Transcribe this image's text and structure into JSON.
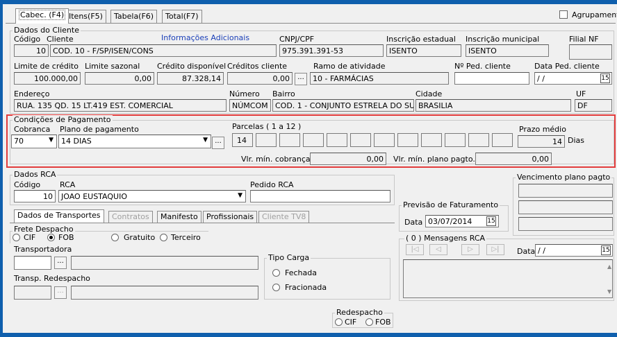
{
  "tabs": [
    {
      "label": "Cabec. (F4)"
    },
    {
      "label": "Itens(F5)"
    },
    {
      "label": "Tabela(F6)"
    },
    {
      "label": "Total(F7)"
    }
  ],
  "agrupamento_label": "Agrupament",
  "cliente": {
    "group_title": "Dados do Cliente",
    "codigo_label": "Código",
    "codigo_value": "10",
    "cliente_label": "Cliente",
    "cliente_value": "COD. 10 - F/SP/ISEN/CONS",
    "info_adicionais_link": "Informações Adicionais",
    "cnpj_label": "CNPJ/CPF",
    "cnpj_value": "975.391.391-53",
    "ie_label": "Inscrição estadual",
    "ie_value": "ISENTO",
    "im_label": "Inscrição municipal",
    "im_value": "ISENTO",
    "filial_label": "Filial NF",
    "filial_value": "",
    "limite_credito_label": "Limite de crédito",
    "limite_credito_value": "100.000,00",
    "limite_sazonal_label": "Limite sazonal",
    "limite_sazonal_value": "0,00",
    "credito_disp_label": "Crédito disponível",
    "credito_disp_value": "87.328,14",
    "creditos_cliente_label": "Créditos cliente",
    "creditos_cliente_value": "0,00",
    "ramo_label": "Ramo de atividade",
    "ramo_value": "10 - FARMÁCIAS",
    "ped_cliente_label": "Nº Ped. cliente",
    "ped_cliente_value": "",
    "data_ped_label": "Data Ped. cliente",
    "data_ped_value": "/ /",
    "endereco_label": "Endereço",
    "endereco_value": "RUA. 135 QD. 15 LT.419 EST. COMERCIAL",
    "numero_label": "Número",
    "numero_value": "NÚMCOM",
    "bairro_label": "Bairro",
    "bairro_value": "COD. 1 - CONJUNTO ESTRELA DO SU",
    "cidade_label": "Cidade",
    "cidade_value": "BRASILIA",
    "uf_label": "UF",
    "uf_value": "DF"
  },
  "pagamento": {
    "group_title": "Condições de Pagamento",
    "cobranca_label": "Cobranca",
    "cobranca_value": "70",
    "plano_label": "Plano de pagamento",
    "plano_value": "14 DIAS",
    "parcelas_label": "Parcelas ( 1 a 12 )",
    "parcela_1": "14",
    "prazo_label": "Prazo médio",
    "prazo_value": "14",
    "dias_label": "Dias",
    "vlr_min_cobranca_label": "Vlr. mín. cobrança",
    "vlr_min_cobranca_value": "0,00",
    "vlr_min_plano_label": "Vlr. mín. plano pagto.",
    "vlr_min_plano_value": "0,00"
  },
  "rca": {
    "group_title": "Dados RCA",
    "codigo_label": "Código",
    "codigo_value": "10",
    "rca_label": "RCA",
    "rca_value": "JOAO EUSTAQUIO",
    "pedido_label": "Pedido RCA",
    "pedido_value": ""
  },
  "vencimento_title": "Vencimento plano pagto",
  "previsao": {
    "title": "Previsão de Faturamento",
    "data_label": "Data",
    "data_value": "03/07/2014"
  },
  "mensagens": {
    "title": "( 0 ) Mensagens RCA",
    "data_label": "Data",
    "data_value": "/ /"
  },
  "subtabs": [
    {
      "label": "Dados de Transportes"
    },
    {
      "label": "Contratos"
    },
    {
      "label": "Manifesto"
    },
    {
      "label": "Profissionais"
    },
    {
      "label": "Cliente TV8"
    }
  ],
  "transporte": {
    "frete_title": "Frete Despacho",
    "cif": "CIF",
    "fob": "FOB",
    "gratuito": "Gratuito",
    "terceiro": "Terceiro",
    "transportadora_label": "Transportadora",
    "transp_redespacho_label": "Transp. Redespacho",
    "tipo_carga_title": "Tipo Carga",
    "fechada": "Fechada",
    "fracionada": "Fracionada",
    "redespacho_title": "Redespacho",
    "redesp_cif": "CIF",
    "redesp_fob": "FOB"
  }
}
